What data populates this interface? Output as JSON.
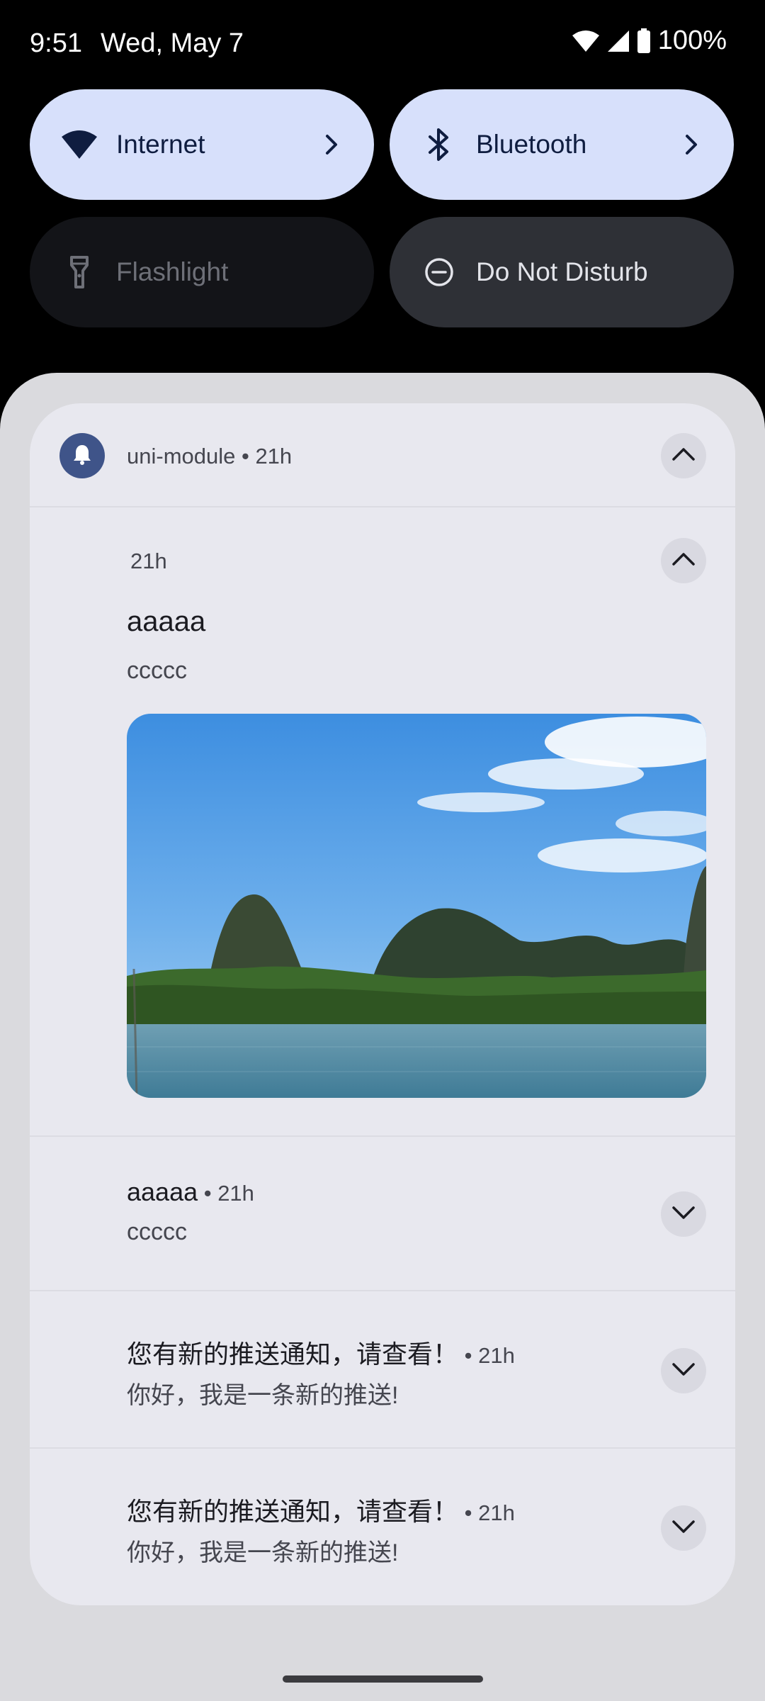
{
  "status_bar": {
    "time": "9:51",
    "date": "Wed, May 7",
    "battery": "100%",
    "icons": [
      "wifi-icon",
      "signal-icon",
      "battery-icon"
    ]
  },
  "quick_settings": {
    "tiles": [
      {
        "label": "Internet",
        "icon": "wifi-icon",
        "state": "on"
      },
      {
        "label": "Bluetooth",
        "icon": "bluetooth-icon",
        "state": "on"
      },
      {
        "label": "Flashlight",
        "icon": "flashlight-icon",
        "state": "unavailable"
      },
      {
        "label": "Do Not Disturb",
        "icon": "do-not-disturb-icon",
        "state": "off"
      }
    ]
  },
  "notification_group": {
    "app_name": "uni-module",
    "time": "21h",
    "header_text": "uni-module • 21h",
    "expanded": {
      "time": "21h",
      "title": "aaaaa",
      "body": "ccccc",
      "picture": "landscape-photo"
    },
    "items": [
      {
        "title": "aaaaa",
        "meta": " • 21h",
        "body": "ccccc"
      },
      {
        "title": "您有新的推送通知，请查看！",
        "meta": " • 21h",
        "body": "你好，我是一条新的推送!"
      },
      {
        "title": "您有新的推送通知，请查看！",
        "meta": " • 21h",
        "body": "你好，我是一条新的推送!"
      }
    ]
  },
  "colors": {
    "tile_active": "#d7e0fb",
    "tile_off": "#2e3036",
    "shade_bg": "#dadade",
    "card_bg": "#e8e8ef",
    "app_icon_bg": "#3f5489"
  }
}
